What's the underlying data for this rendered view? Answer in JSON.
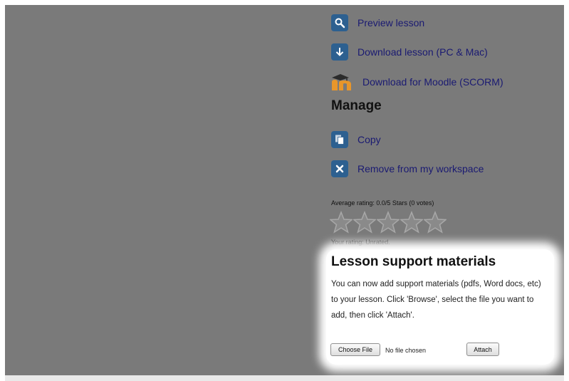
{
  "actions": {
    "preview_label": "Preview lesson",
    "download_label": "Download lesson (PC & Mac)",
    "moodle_label": "Download for Moodle (SCORM)"
  },
  "manage": {
    "heading": "Manage",
    "copy_label": "Copy",
    "remove_label": "Remove from my workspace"
  },
  "rating": {
    "average_text": "Average rating: 0.0/5 Stars (0 votes)",
    "your_rating_text": "Your rating: Unrated.",
    "stars_filled": 0,
    "stars_total": 5
  },
  "support": {
    "title": "Lesson support materials",
    "description": "You can now add support materials (pdfs, Word docs, etc) to your lesson. Click 'Browse', select the file you want to add, then click 'Attach'.",
    "choose_file_label": "Choose File",
    "no_file_text": "No file chosen",
    "attach_label": "Attach"
  },
  "colors": {
    "dimmed_overlay": "#7a7a7a",
    "link": "#1a1a72",
    "icon_blue": "#2d6090",
    "moodle_orange": "#e8962a"
  },
  "icons": [
    "magnifier-icon",
    "download-arrow-icon",
    "moodle-logo-icon",
    "copy-pages-icon",
    "close-x-icon",
    "star-icon"
  ]
}
